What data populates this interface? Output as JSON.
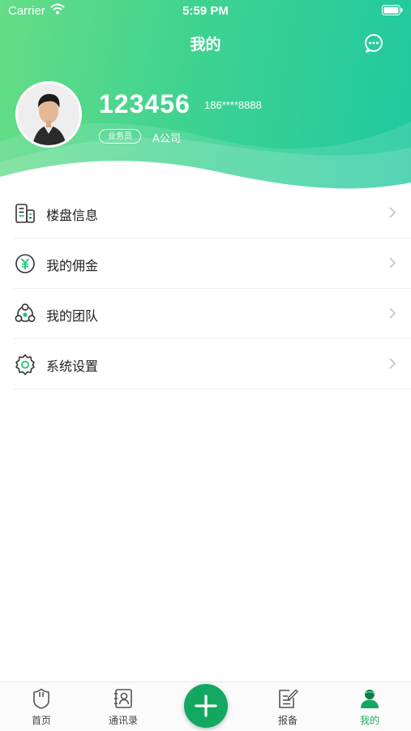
{
  "status_bar": {
    "carrier": "Carrier",
    "time": "5:59 PM"
  },
  "header": {
    "title": "我的"
  },
  "profile": {
    "user_id": "123456",
    "phone": "186****8888",
    "role": "业务员",
    "company": "A公司"
  },
  "menu": [
    {
      "label": "楼盘信息",
      "icon": "building-icon"
    },
    {
      "label": "我的佣金",
      "icon": "yuan-coin-icon"
    },
    {
      "label": "我的团队",
      "icon": "team-icon"
    },
    {
      "label": "系统设置",
      "icon": "gear-icon"
    }
  ],
  "tabbar": {
    "tabs": [
      {
        "label": "首页",
        "icon": "home-shield-icon",
        "active": false
      },
      {
        "label": "通讯录",
        "icon": "contacts-icon",
        "active": false
      },
      {
        "label": "报备",
        "icon": "report-edit-icon",
        "active": false
      },
      {
        "label": "我的",
        "icon": "user-icon",
        "active": true
      }
    ],
    "center_button_icon": "plus-icon"
  },
  "colors": {
    "header_gradient_start": "#66dd86",
    "header_gradient_end": "#1fc8a0",
    "accent_green": "#13a862",
    "active_tab": "#1daa62"
  }
}
